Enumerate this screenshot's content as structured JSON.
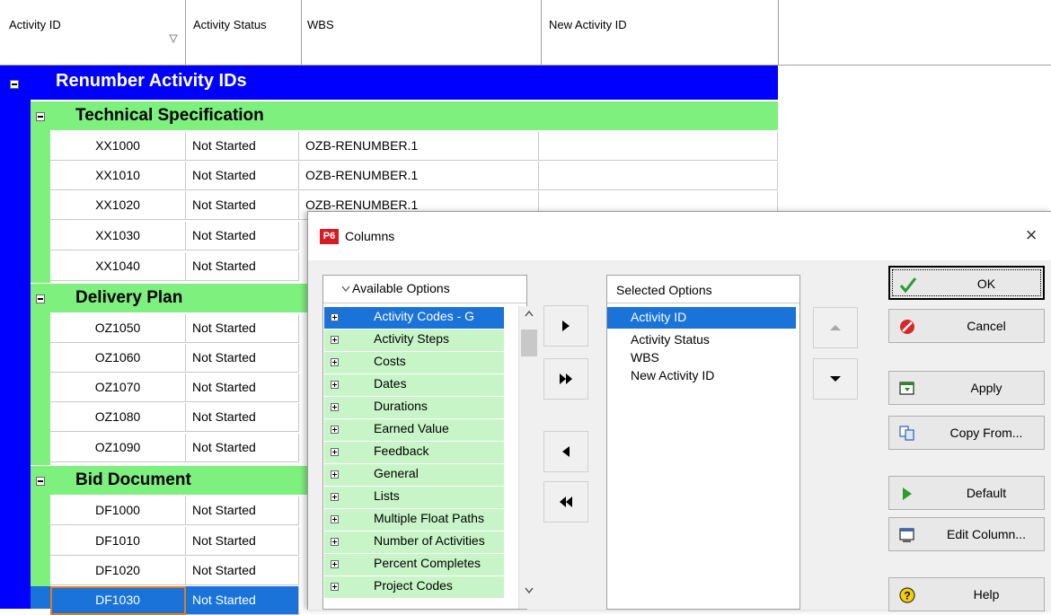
{
  "grid": {
    "columns": {
      "activity_id": "Activity ID",
      "activity_status": "Activity Status",
      "wbs": "WBS",
      "new_activity_id": "New Activity ID"
    },
    "project_title": "Renumber Activity IDs",
    "groups": [
      {
        "title": "Technical Specification",
        "rows": [
          {
            "id": "XX1000",
            "status": "Not Started",
            "wbs": "OZB-RENUMBER.1"
          },
          {
            "id": "XX1010",
            "status": "Not Started",
            "wbs": "OZB-RENUMBER.1"
          },
          {
            "id": "XX1020",
            "status": "Not Started",
            "wbs": "OZB-RENUMBER.1"
          },
          {
            "id": "XX1030",
            "status": "Not Started",
            "wbs": ""
          },
          {
            "id": "XX1040",
            "status": "Not Started",
            "wbs": ""
          }
        ]
      },
      {
        "title": "Delivery Plan",
        "rows": [
          {
            "id": "OZ1050",
            "status": "Not Started",
            "wbs": ""
          },
          {
            "id": "OZ1060",
            "status": "Not Started",
            "wbs": ""
          },
          {
            "id": "OZ1070",
            "status": "Not Started",
            "wbs": ""
          },
          {
            "id": "OZ1080",
            "status": "Not Started",
            "wbs": ""
          },
          {
            "id": "OZ1090",
            "status": "Not Started",
            "wbs": ""
          }
        ]
      },
      {
        "title": "Bid Document",
        "rows": [
          {
            "id": "DF1000",
            "status": "Not Started",
            "wbs": ""
          },
          {
            "id": "DF1010",
            "status": "Not Started",
            "wbs": ""
          },
          {
            "id": "DF1020",
            "status": "Not Started",
            "wbs": ""
          },
          {
            "id": "DF1030",
            "status": "Not Started",
            "wbs": ""
          }
        ]
      }
    ]
  },
  "dialog": {
    "logo": "P6",
    "title": "Columns",
    "close": "×",
    "available_header": "Available Options",
    "available_options": [
      "Activity Codes - G",
      "Activity Steps",
      "Costs",
      "Dates",
      "Durations",
      "Earned Value",
      "Feedback",
      "General",
      "Lists",
      "Multiple Float Paths",
      "Number of Activities",
      "Percent Completes",
      "Project Codes"
    ],
    "selected_header": "Selected Options",
    "selected_options": [
      "Activity ID",
      "Activity Status",
      "WBS",
      "New Activity ID"
    ],
    "buttons": {
      "ok": "OK",
      "cancel": "Cancel",
      "apply": "Apply",
      "copy_from": "Copy From...",
      "default": "Default",
      "edit_column": "Edit Column...",
      "help": "Help"
    }
  },
  "colors": {
    "project_band": "#0000ff",
    "wbs_band": "#7ef07e",
    "selection": "#1a73d9",
    "available_item_bg": "#c8f5c8"
  }
}
